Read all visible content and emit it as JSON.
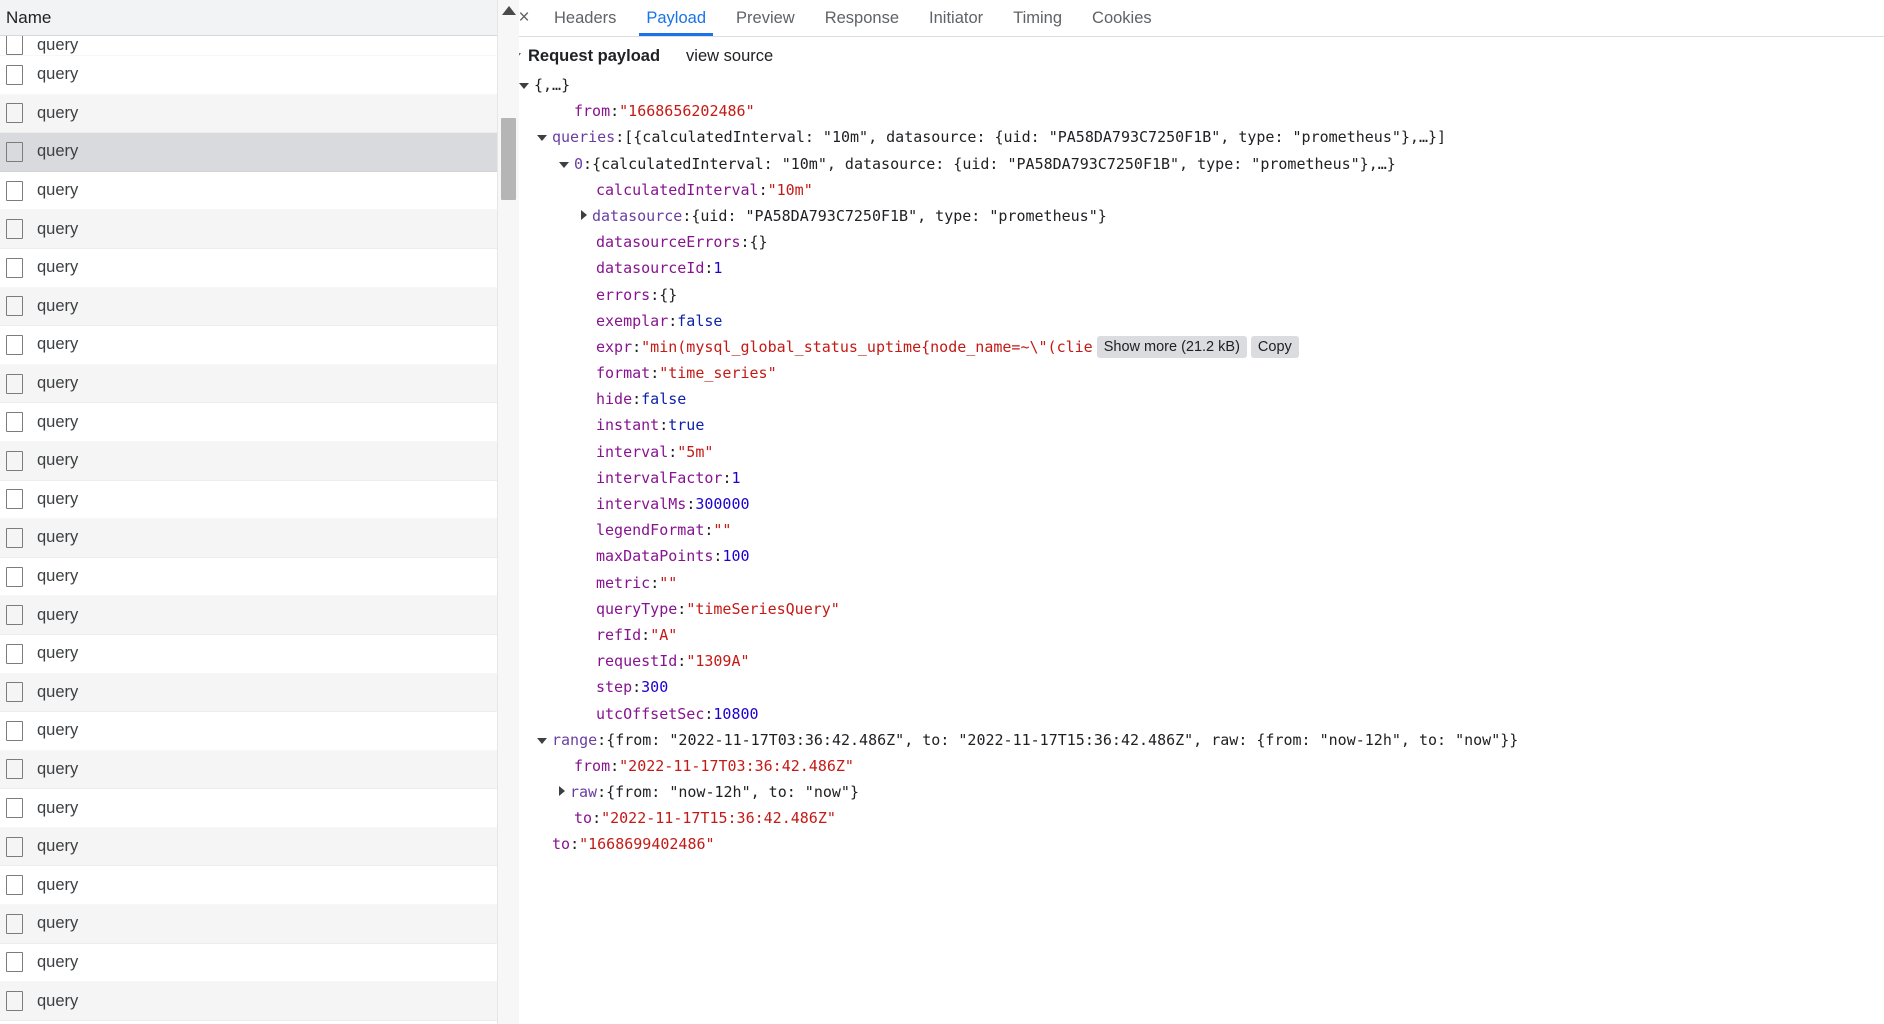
{
  "left_panel": {
    "column_header": "Name",
    "rows": [
      {
        "name": "query",
        "state": "partial"
      },
      {
        "name": "query",
        "state": "normal"
      },
      {
        "name": "query",
        "state": "alt"
      },
      {
        "name": "query",
        "state": "selected"
      },
      {
        "name": "query",
        "state": "normal"
      },
      {
        "name": "query",
        "state": "alt"
      },
      {
        "name": "query",
        "state": "normal"
      },
      {
        "name": "query",
        "state": "alt"
      },
      {
        "name": "query",
        "state": "normal"
      },
      {
        "name": "query",
        "state": "alt"
      },
      {
        "name": "query",
        "state": "normal"
      },
      {
        "name": "query",
        "state": "alt"
      },
      {
        "name": "query",
        "state": "normal"
      },
      {
        "name": "query",
        "state": "alt"
      },
      {
        "name": "query",
        "state": "normal"
      },
      {
        "name": "query",
        "state": "alt"
      },
      {
        "name": "query",
        "state": "normal"
      },
      {
        "name": "query",
        "state": "alt"
      },
      {
        "name": "query",
        "state": "normal"
      },
      {
        "name": "query",
        "state": "alt"
      },
      {
        "name": "query",
        "state": "normal"
      },
      {
        "name": "query",
        "state": "alt"
      },
      {
        "name": "query",
        "state": "normal"
      },
      {
        "name": "query",
        "state": "alt"
      },
      {
        "name": "query",
        "state": "normal"
      },
      {
        "name": "query",
        "state": "alt"
      }
    ]
  },
  "detail_tabs": {
    "close_label": "×",
    "items": [
      {
        "label": "Headers",
        "active": false
      },
      {
        "label": "Payload",
        "active": true
      },
      {
        "label": "Preview",
        "active": false
      },
      {
        "label": "Response",
        "active": false
      },
      {
        "label": "Initiator",
        "active": false
      },
      {
        "label": "Timing",
        "active": false
      },
      {
        "label": "Cookies",
        "active": false
      }
    ]
  },
  "payload": {
    "section_title": "Request payload",
    "view_source_label": "view source",
    "root_label": "{,…}",
    "show_more_label": "Show more (21.2 kB)",
    "copy_label": "Copy",
    "rows": [
      {
        "id": "from",
        "indent": 1,
        "twisty": "none",
        "key": "from",
        "sep": ": ",
        "value": "\"1668656202486\"",
        "value_kind": "string"
      },
      {
        "id": "queries",
        "indent": 0,
        "twisty": "down",
        "key": "queries",
        "sep": ": ",
        "value": "[{calculatedInterval: \"10m\", datasource: {uid: \"PA58DA793C7250F1B\", type: \"prometheus\"},…}]",
        "value_kind": "object"
      },
      {
        "id": "queries-0",
        "indent": 1,
        "twisty": "down",
        "key": "0",
        "sep": ": ",
        "value": "{calculatedInterval: \"10m\", datasource: {uid: \"PA58DA793C7250F1B\", type: \"prometheus\"},…}",
        "value_kind": "object"
      },
      {
        "id": "calculatedInterval",
        "indent": 2,
        "twisty": "none",
        "key": "calculatedInterval",
        "sep": ": ",
        "value": "\"10m\"",
        "value_kind": "string"
      },
      {
        "id": "datasource",
        "indent": 2,
        "twisty": "right",
        "key": "datasource",
        "sep": ": ",
        "value": "{uid: \"PA58DA793C7250F1B\", type: \"prometheus\"}",
        "value_kind": "object"
      },
      {
        "id": "datasourceErrors",
        "indent": 2,
        "twisty": "none",
        "key": "datasourceErrors",
        "sep": ": ",
        "value": "{}",
        "value_kind": "object"
      },
      {
        "id": "datasourceId",
        "indent": 2,
        "twisty": "none",
        "key": "datasourceId",
        "sep": ": ",
        "value": "1",
        "value_kind": "number"
      },
      {
        "id": "errors",
        "indent": 2,
        "twisty": "none",
        "key": "errors",
        "sep": ": ",
        "value": "{}",
        "value_kind": "object"
      },
      {
        "id": "exemplar",
        "indent": 2,
        "twisty": "none",
        "key": "exemplar",
        "sep": ": ",
        "value": "false",
        "value_kind": "boolean"
      },
      {
        "id": "expr",
        "indent": 2,
        "twisty": "none",
        "key": "expr",
        "sep": ": ",
        "value": "\"min(mysql_global_status_uptime{node_name=~\\\"(clie",
        "value_kind": "string",
        "truncated": true
      },
      {
        "id": "format",
        "indent": 2,
        "twisty": "none",
        "key": "format",
        "sep": ": ",
        "value": "\"time_series\"",
        "value_kind": "string"
      },
      {
        "id": "hide",
        "indent": 2,
        "twisty": "none",
        "key": "hide",
        "sep": ": ",
        "value": "false",
        "value_kind": "boolean"
      },
      {
        "id": "instant",
        "indent": 2,
        "twisty": "none",
        "key": "instant",
        "sep": ": ",
        "value": "true",
        "value_kind": "boolean"
      },
      {
        "id": "interval",
        "indent": 2,
        "twisty": "none",
        "key": "interval",
        "sep": ": ",
        "value": "\"5m\"",
        "value_kind": "string"
      },
      {
        "id": "intervalFactor",
        "indent": 2,
        "twisty": "none",
        "key": "intervalFactor",
        "sep": ": ",
        "value": "1",
        "value_kind": "number"
      },
      {
        "id": "intervalMs",
        "indent": 2,
        "twisty": "none",
        "key": "intervalMs",
        "sep": ": ",
        "value": "300000",
        "value_kind": "number"
      },
      {
        "id": "legendFormat",
        "indent": 2,
        "twisty": "none",
        "key": "legendFormat",
        "sep": ": ",
        "value": "\"\"",
        "value_kind": "string"
      },
      {
        "id": "maxDataPoints",
        "indent": 2,
        "twisty": "none",
        "key": "maxDataPoints",
        "sep": ": ",
        "value": "100",
        "value_kind": "number"
      },
      {
        "id": "metric",
        "indent": 2,
        "twisty": "none",
        "key": "metric",
        "sep": ": ",
        "value": "\"\"",
        "value_kind": "string"
      },
      {
        "id": "queryType",
        "indent": 2,
        "twisty": "none",
        "key": "queryType",
        "sep": ": ",
        "value": "\"timeSeriesQuery\"",
        "value_kind": "string"
      },
      {
        "id": "refId",
        "indent": 2,
        "twisty": "none",
        "key": "refId",
        "sep": ": ",
        "value": "\"A\"",
        "value_kind": "string"
      },
      {
        "id": "requestId",
        "indent": 2,
        "twisty": "none",
        "key": "requestId",
        "sep": ": ",
        "value": "\"1309A\"",
        "value_kind": "string"
      },
      {
        "id": "step",
        "indent": 2,
        "twisty": "none",
        "key": "step",
        "sep": ": ",
        "value": "300",
        "value_kind": "number"
      },
      {
        "id": "utcOffsetSec",
        "indent": 2,
        "twisty": "none",
        "key": "utcOffsetSec",
        "sep": ": ",
        "value": "10800",
        "value_kind": "number"
      },
      {
        "id": "range",
        "indent": 0,
        "twisty": "down",
        "key": "range",
        "sep": ": ",
        "value": "{from: \"2022-11-17T03:36:42.486Z\", to: \"2022-11-17T15:36:42.486Z\", raw: {from: \"now-12h\", to: \"now\"}}",
        "value_kind": "object"
      },
      {
        "id": "range-from",
        "indent": 1,
        "twisty": "none",
        "key": "from",
        "sep": ": ",
        "value": "\"2022-11-17T03:36:42.486Z\"",
        "value_kind": "string"
      },
      {
        "id": "range-raw",
        "indent": 1,
        "twisty": "right",
        "key": "raw",
        "sep": ": ",
        "value": "{from: \"now-12h\", to: \"now\"}",
        "value_kind": "object"
      },
      {
        "id": "range-to",
        "indent": 1,
        "twisty": "none",
        "key": "to",
        "sep": ": ",
        "value": "\"2022-11-17T15:36:42.486Z\"",
        "value_kind": "string"
      },
      {
        "id": "to",
        "indent": 0,
        "twisty": "none",
        "key": "to",
        "sep": ": ",
        "value": "\"1668699402486\"",
        "value_kind": "string"
      }
    ]
  },
  "colors": {
    "accent": "#1a73e8",
    "key": "#881391",
    "string": "#c41a16",
    "number": "#1c00cf",
    "selected_row": "#d8dade"
  }
}
